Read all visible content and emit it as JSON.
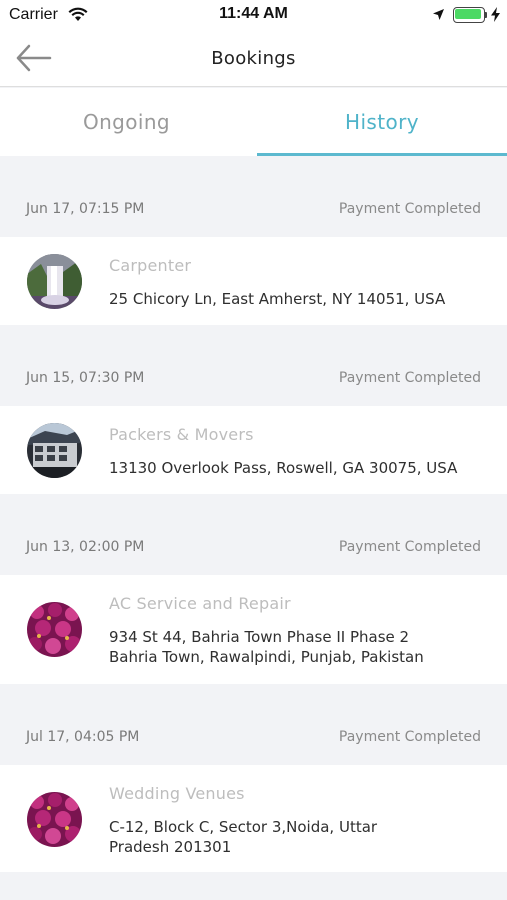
{
  "status_bar": {
    "carrier": "Carrier",
    "time": "11:44 AM"
  },
  "nav": {
    "title": "Bookings"
  },
  "tabs": [
    {
      "label": "Ongoing",
      "active": false
    },
    {
      "label": "History",
      "active": true
    }
  ],
  "colors": {
    "accent": "#5cb9cf",
    "battery": "#4cd964",
    "background": "#f2f3f6"
  },
  "bookings": [
    {
      "date": "Jun 17, 07:15 PM",
      "status": "Payment Completed",
      "service": "Carpenter",
      "address": "25 Chicory Ln, East Amherst, NY 14051, USA",
      "image": "waterfall-photo"
    },
    {
      "date": "Jun 15, 07:30 PM",
      "status": "Payment Completed",
      "service": "Packers & Movers",
      "address": "13130 Overlook Pass, Roswell, GA 30075, USA",
      "image": "building-photo"
    },
    {
      "date": "Jun 13, 02:00 PM",
      "status": "Payment Completed",
      "service": "AC Service and Repair",
      "address_lines": [
        "934 St 44, Bahria Town Phase II Phase 2",
        "Bahria Town, Rawalpindi, Punjab, Pakistan"
      ],
      "image": "flowers-photo"
    },
    {
      "date": "Jul 17, 04:05 PM",
      "status": "Payment Completed",
      "service": "Wedding Venues",
      "address_lines": [
        "C-12, Block C, Sector 3,Noida, Uttar",
        "Pradesh 201301"
      ],
      "image": "flowers-photo"
    }
  ]
}
